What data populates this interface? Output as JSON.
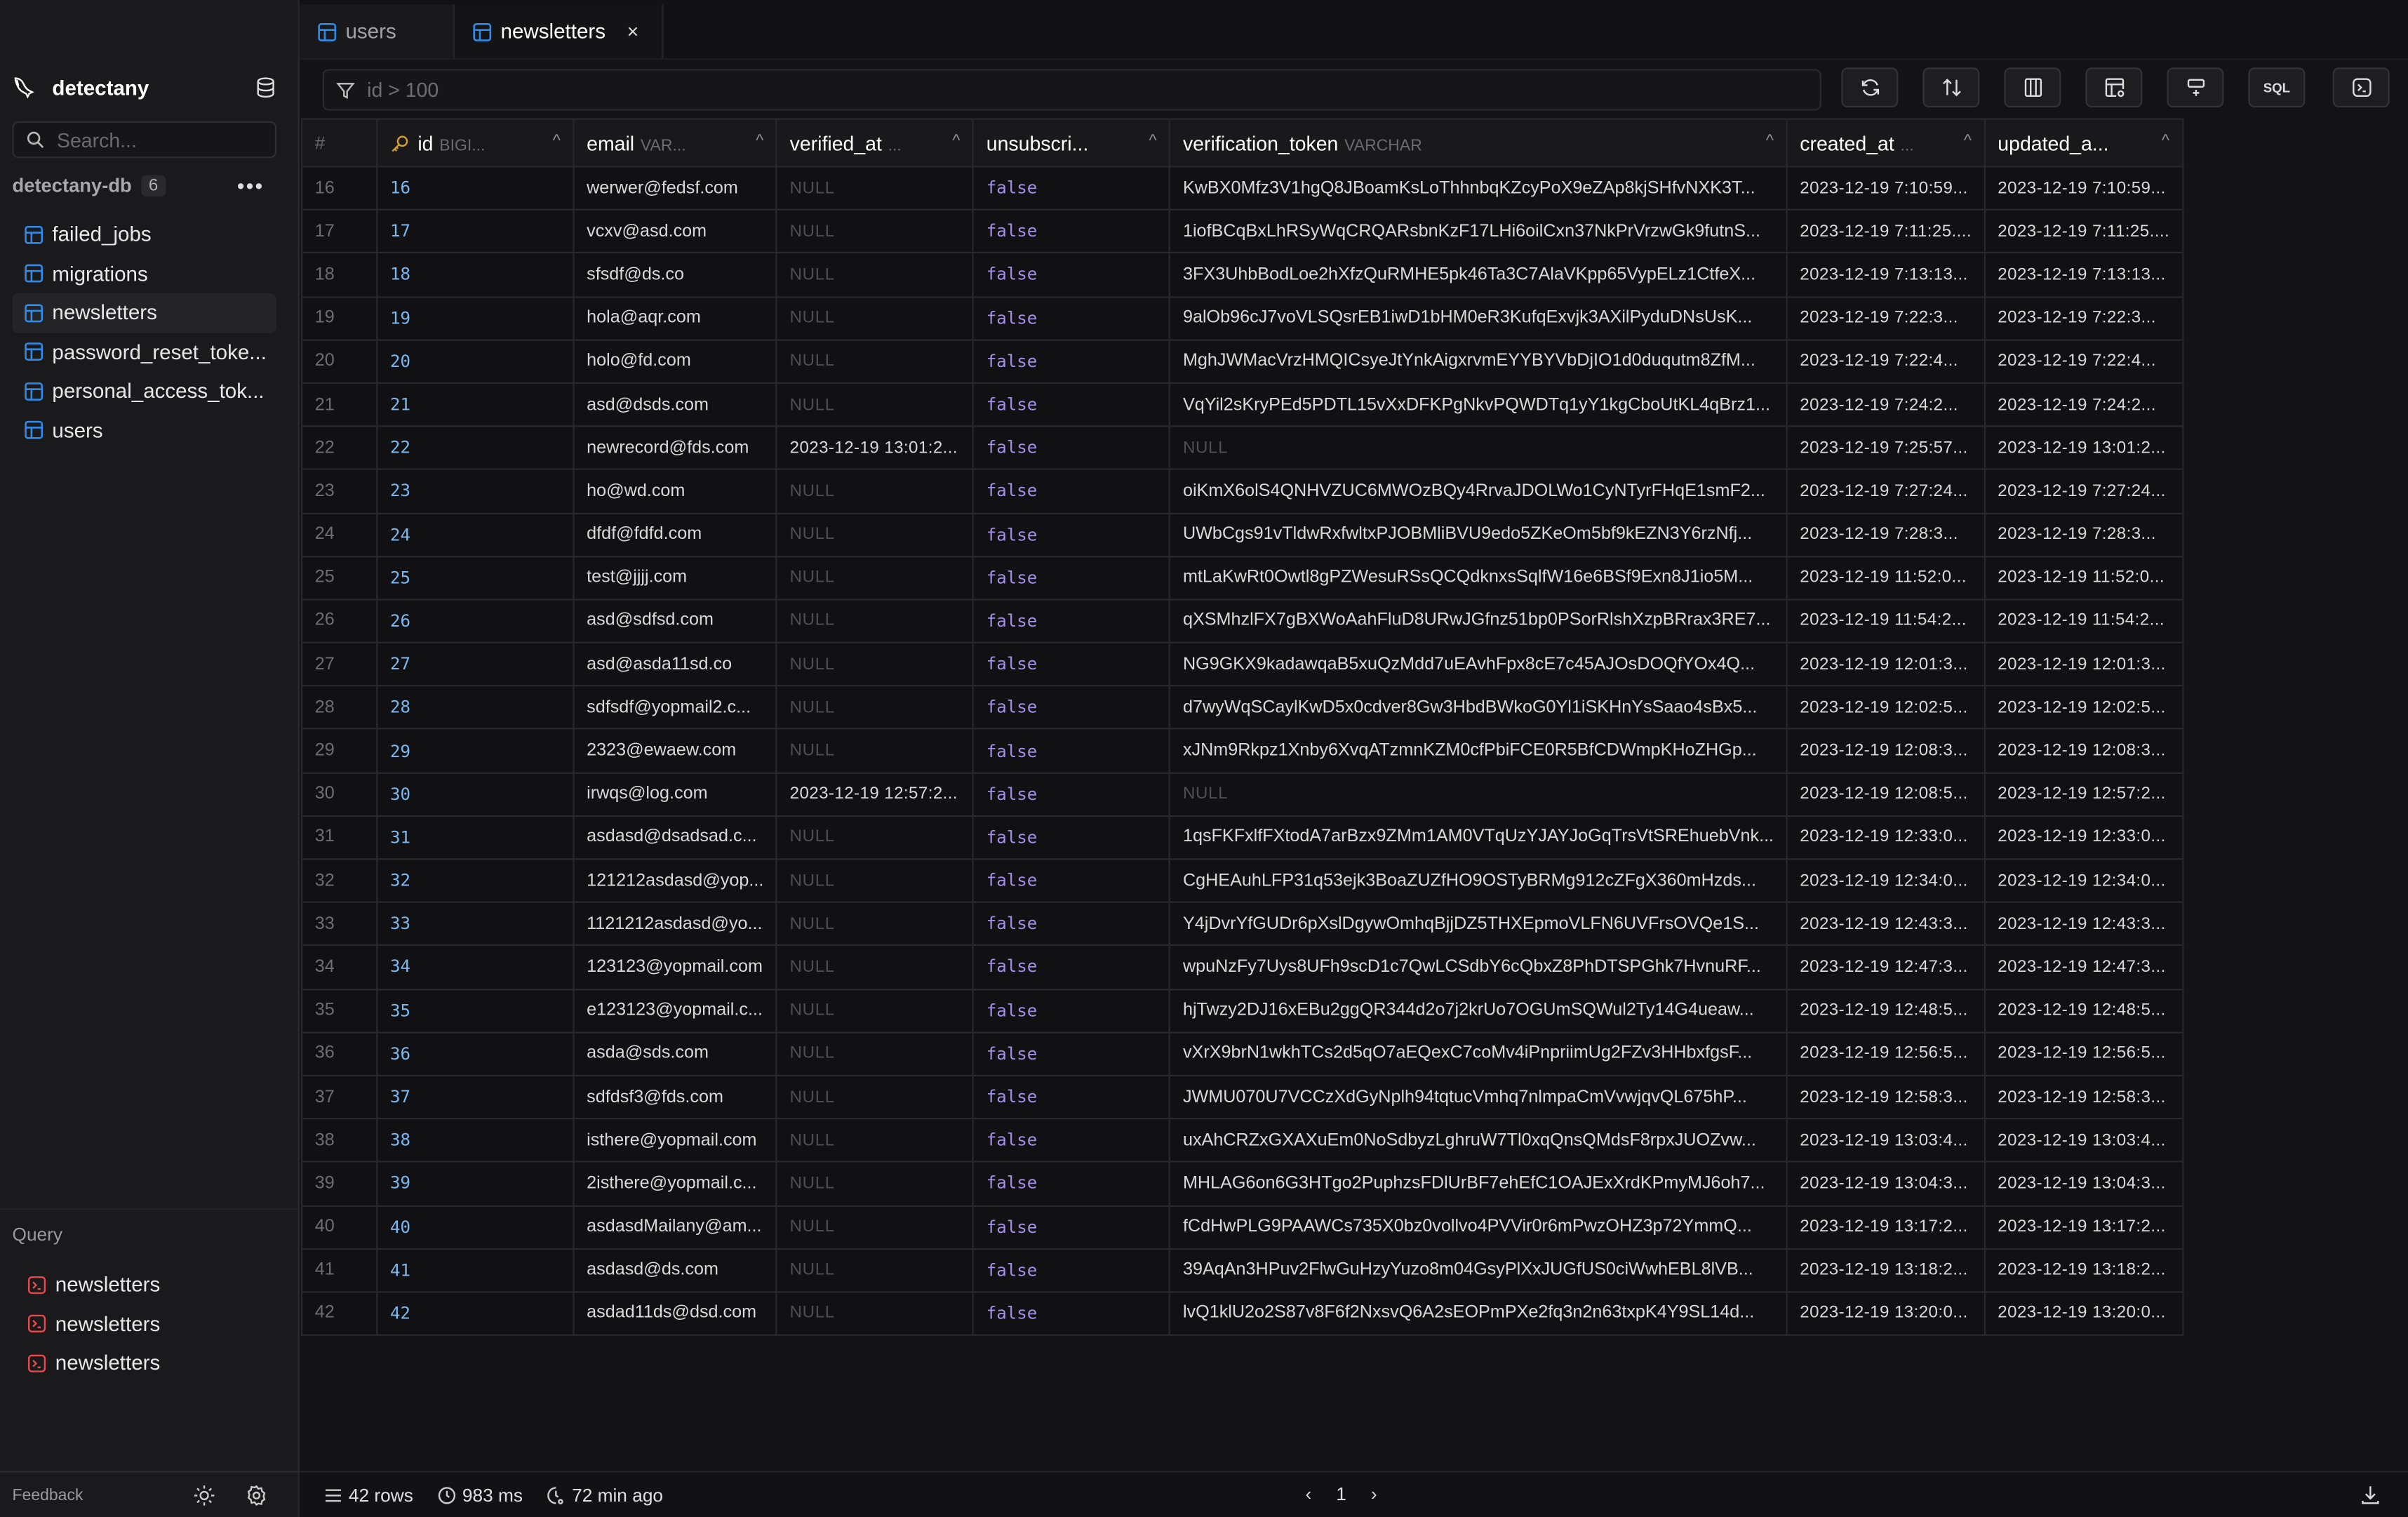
{
  "sidebar": {
    "app_name": "detectany",
    "search_placeholder": "Search...",
    "database": {
      "name": "detectany-db",
      "table_count": "6",
      "more_label": "•••"
    },
    "tables": [
      {
        "label": "failed_jobs",
        "active": false
      },
      {
        "label": "migrations",
        "active": false
      },
      {
        "label": "newsletters",
        "active": true
      },
      {
        "label": "password_reset_toke...",
        "active": false
      },
      {
        "label": "personal_access_tok...",
        "active": false
      },
      {
        "label": "users",
        "active": false
      }
    ],
    "query_section_label": "Query",
    "queries": [
      {
        "label": "newsletters"
      },
      {
        "label": "newsletters"
      },
      {
        "label": "newsletters"
      }
    ],
    "feedback_label": "Feedback"
  },
  "tabs": [
    {
      "label": "users",
      "active": false
    },
    {
      "label": "newsletters",
      "active": true,
      "close": "×"
    }
  ],
  "filter": {
    "placeholder": "id > 100",
    "value": ""
  },
  "toolbar": {
    "buttons": [
      "refresh",
      "sort",
      "columns",
      "table-settings",
      "add-row",
      "sql",
      "console"
    ],
    "sql_label": "SQL"
  },
  "table": {
    "columns": [
      {
        "name": "#",
        "type": ""
      },
      {
        "name": "id",
        "type": "BIGI...",
        "primary_key": true
      },
      {
        "name": "email",
        "type": "VAR..."
      },
      {
        "name": "verified_at",
        "type": "..."
      },
      {
        "name": "unsubscri...",
        "type": ""
      },
      {
        "name": "verification_token",
        "type": "VARCHAR"
      },
      {
        "name": "created_at",
        "type": "..."
      },
      {
        "name": "updated_a...",
        "type": ""
      }
    ],
    "sort_glyph": "^",
    "rows": [
      [
        "16",
        "16",
        "werwer@fedsf.com",
        "NULL",
        "false",
        "KwBX0Mfz3V1hgQ8JBoamKsLoThhnbqKZcyPoX9eZAp8kjSHfvNXK3T...",
        "2023-12-19 7:10:59...",
        "2023-12-19 7:10:59..."
      ],
      [
        "17",
        "17",
        "vcxv@asd.com",
        "NULL",
        "false",
        "1iofBCqBxLhRSyWqCRQARsbnKzF17LHi6oilCxn37NkPrVrzwGk9futnS...",
        "2023-12-19 7:11:25....",
        "2023-12-19 7:11:25...."
      ],
      [
        "18",
        "18",
        "sfsdf@ds.co",
        "NULL",
        "false",
        "3FX3UhbBodLoe2hXfzQuRMHE5pk46Ta3C7AlaVKpp65VypELz1CtfeX...",
        "2023-12-19 7:13:13...",
        "2023-12-19 7:13:13..."
      ],
      [
        "19",
        "19",
        "hola@aqr.com",
        "NULL",
        "false",
        "9alOb96cJ7voVLSQsrEB1iwD1bHM0eR3KufqExvjk3AXilPyduDNsUsK...",
        "2023-12-19 7:22:3...",
        "2023-12-19 7:22:3..."
      ],
      [
        "20",
        "20",
        "holo@fd.com",
        "NULL",
        "false",
        "MghJWMacVrzHMQICsyeJtYnkAigxrvmEYYBYVbDjIO1d0duqutm8ZfM...",
        "2023-12-19 7:22:4...",
        "2023-12-19 7:22:4..."
      ],
      [
        "21",
        "21",
        "asd@dsds.com",
        "NULL",
        "false",
        "VqYil2sKryPEd5PDTL15vXxDFKPgNkvPQWDTq1yY1kgCboUtKL4qBrz1...",
        "2023-12-19 7:24:2...",
        "2023-12-19 7:24:2..."
      ],
      [
        "22",
        "22",
        "newrecord@fds.com",
        "2023-12-19 13:01:2...",
        "false",
        "NULL",
        "2023-12-19 7:25:57...",
        "2023-12-19 13:01:2..."
      ],
      [
        "23",
        "23",
        "ho@wd.com",
        "NULL",
        "false",
        "oiKmX6olS4QNHVZUC6MWOzBQy4RrvaJDOLWo1CyNTyrFHqE1smF2...",
        "2023-12-19 7:27:24...",
        "2023-12-19 7:27:24..."
      ],
      [
        "24",
        "24",
        "dfdf@fdfd.com",
        "NULL",
        "false",
        "UWbCgs91vTldwRxfwltxPJOBMliBVU9edo5ZKeOm5bf9kEZN3Y6rzNfj...",
        "2023-12-19 7:28:3...",
        "2023-12-19 7:28:3..."
      ],
      [
        "25",
        "25",
        "test@jjjj.com",
        "NULL",
        "false",
        "mtLaKwRt0Owtl8gPZWesuRSsQCQdknxsSqlfW16e6BSf9Exn8J1io5M...",
        "2023-12-19 11:52:0...",
        "2023-12-19 11:52:0..."
      ],
      [
        "26",
        "26",
        "asd@sdfsd.com",
        "NULL",
        "false",
        "qXSMhzlFX7gBXWoAahFluD8URwJGfnz51bp0PSorRlshXzpBRrax3RE7...",
        "2023-12-19 11:54:2...",
        "2023-12-19 11:54:2..."
      ],
      [
        "27",
        "27",
        "asd@asda11sd.co",
        "NULL",
        "false",
        "NG9GKX9kadawqaB5xuQzMdd7uEAvhFpx8cE7c45AJOsDOQfYOx4Q...",
        "2023-12-19 12:01:3...",
        "2023-12-19 12:01:3..."
      ],
      [
        "28",
        "28",
        "sdfsdf@yopmail2.c...",
        "NULL",
        "false",
        "d7wyWqSCaylKwD5x0cdver8Gw3HbdBWkoG0Yl1iSKHnYsSaao4sBx5...",
        "2023-12-19 12:02:5...",
        "2023-12-19 12:02:5..."
      ],
      [
        "29",
        "29",
        "2323@ewaew.com",
        "NULL",
        "false",
        "xJNm9Rkpz1Xnby6XvqATzmnKZM0cfPbiFCE0R5BfCDWmpKHoZHGp...",
        "2023-12-19 12:08:3...",
        "2023-12-19 12:08:3..."
      ],
      [
        "30",
        "30",
        "irwqs@log.com",
        "2023-12-19 12:57:2...",
        "false",
        "NULL",
        "2023-12-19 12:08:5...",
        "2023-12-19 12:57:2..."
      ],
      [
        "31",
        "31",
        "asdasd@dsadsad.c...",
        "NULL",
        "false",
        "1qsFKFxlfFXtodA7arBzx9ZMm1AM0VTqUzYJAYJoGqTrsVtSREhuebVnk...",
        "2023-12-19 12:33:0...",
        "2023-12-19 12:33:0..."
      ],
      [
        "32",
        "32",
        "121212asdasd@yop...",
        "NULL",
        "false",
        "CgHEAuhLFP31q53ejk3BoaZUZfHO9OSTyBRMg912cZFgX360mHzds...",
        "2023-12-19 12:34:0...",
        "2023-12-19 12:34:0..."
      ],
      [
        "33",
        "33",
        "1121212asdasd@yo...",
        "NULL",
        "false",
        "Y4jDvrYfGUDr6pXslDgywOmhqBjjDZ5THXEpmoVLFN6UVFrsOVQe1S...",
        "2023-12-19 12:43:3...",
        "2023-12-19 12:43:3..."
      ],
      [
        "34",
        "34",
        "123123@yopmail.com",
        "NULL",
        "false",
        "wpuNzFy7Uys8UFh9scD1c7QwLCSdbY6cQbxZ8PhDTSPGhk7HvnuRF...",
        "2023-12-19 12:47:3...",
        "2023-12-19 12:47:3..."
      ],
      [
        "35",
        "35",
        "e123123@yopmail.c...",
        "NULL",
        "false",
        "hjTwzy2DJ16xEBu2ggQR344d2o7j2krUo7OGUmSQWul2Ty14G4ueaw...",
        "2023-12-19 12:48:5...",
        "2023-12-19 12:48:5..."
      ],
      [
        "36",
        "36",
        "asda@sds.com",
        "NULL",
        "false",
        "vXrX9brN1wkhTCs2d5qO7aEQexC7coMv4iPnpriimUg2FZv3HHbxfgsF...",
        "2023-12-19 12:56:5...",
        "2023-12-19 12:56:5..."
      ],
      [
        "37",
        "37",
        "sdfdsf3@fds.com",
        "NULL",
        "false",
        "JWMU070U7VCCzXdGyNplh94tqtucVmhq7nlmpaCmVvwjqvQL675hP...",
        "2023-12-19 12:58:3...",
        "2023-12-19 12:58:3..."
      ],
      [
        "38",
        "38",
        "isthere@yopmail.com",
        "NULL",
        "false",
        "uxAhCRZxGXAXuEm0NoSdbyzLghruW7Tl0xqQnsQMdsF8rpxJUOZvw...",
        "2023-12-19 13:03:4...",
        "2023-12-19 13:03:4..."
      ],
      [
        "39",
        "39",
        "2isthere@yopmail.c...",
        "NULL",
        "false",
        "MHLAG6on6G3HTgo2PuphzsFDlUrBF7ehEfC1OAJExXrdKPmyMJ6oh7...",
        "2023-12-19 13:04:3...",
        "2023-12-19 13:04:3..."
      ],
      [
        "40",
        "40",
        "asdasdMailany@am...",
        "NULL",
        "false",
        "fCdHwPLG9PAAWCs735X0bz0vollvo4PVVir0r6mPwzOHZ3p72YmmQ...",
        "2023-12-19 13:17:2...",
        "2023-12-19 13:17:2..."
      ],
      [
        "41",
        "41",
        "asdasd@ds.com",
        "NULL",
        "false",
        "39AqAn3HPuv2FlwGuHzyYuzo8m04GsyPlXxJUGfUS0ciWwhEBL8lVB...",
        "2023-12-19 13:18:2...",
        "2023-12-19 13:18:2..."
      ],
      [
        "42",
        "42",
        "asdad11ds@dsd.com",
        "NULL",
        "false",
        "lvQ1klU2o2S87v8F6f2NxsvQ6A2sEOPmPXe2fq3n2n63txpK4Y9SL14d...",
        "2023-12-19 13:20:0...",
        "2023-12-19 13:20:0..."
      ]
    ]
  },
  "status": {
    "rows": "42 rows",
    "duration": "983 ms",
    "last_updated": "72 min ago",
    "page": "1"
  },
  "colors": {
    "accent_blue": "#2f8bea",
    "id_value": "#7cb8f0",
    "boolean_value": "#a58ee8",
    "primary_key": "#d6a02f",
    "query_icon": "#e5484d"
  }
}
